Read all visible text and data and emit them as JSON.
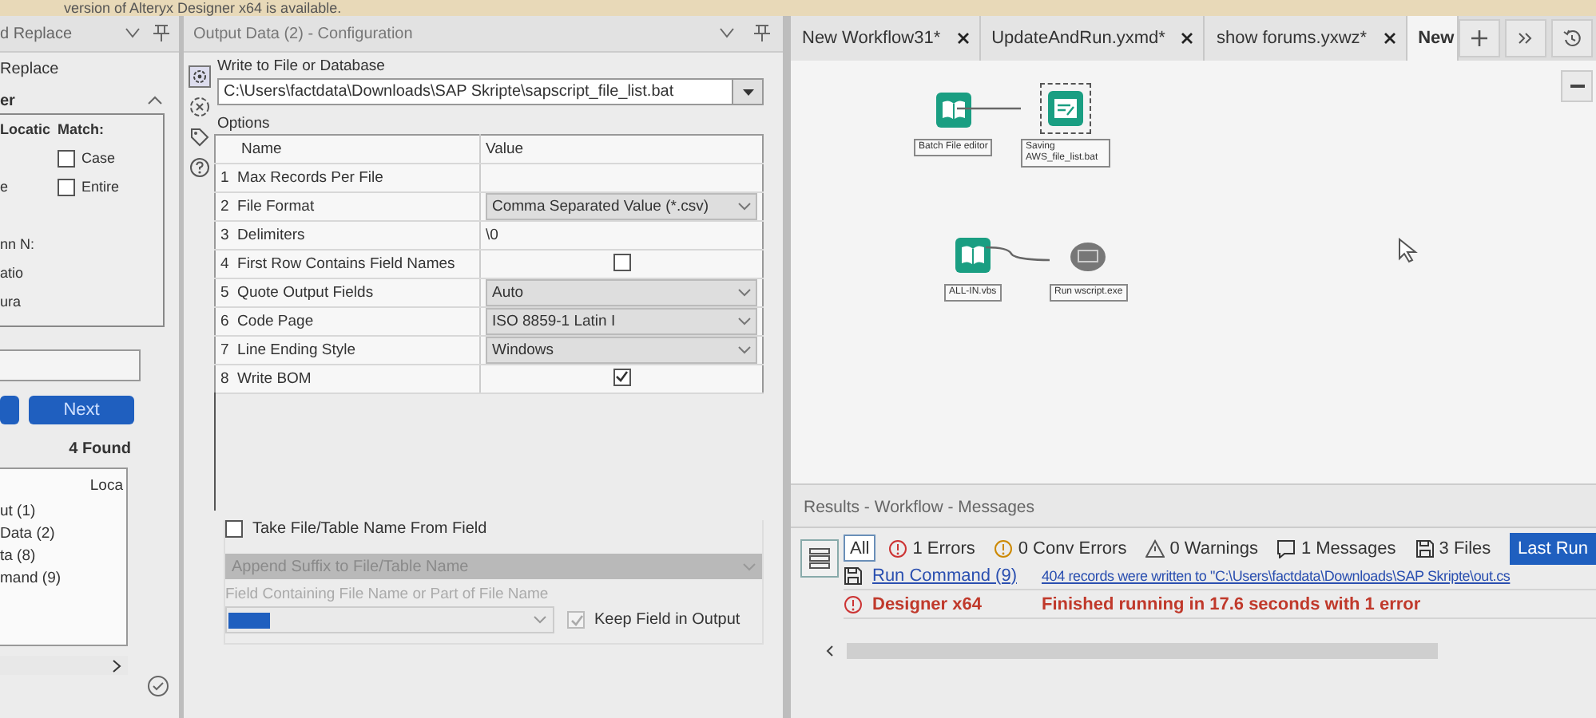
{
  "banner": "version of Alteryx Designer x64 is available.",
  "find_panel": {
    "title": "d Replace",
    "tab": "Replace",
    "section": "er",
    "location_header": "Locatic",
    "match_header": "Match:",
    "location_items": [
      "e",
      "nn N:",
      "atio",
      "ura"
    ],
    "match_options": [
      {
        "label": "Case",
        "checked": false
      },
      {
        "label": "Entire",
        "checked": false
      }
    ],
    "next_button": "Next",
    "found": "4 Found",
    "list_header": "Loca",
    "list_items": [
      "ut (1)",
      "Data (2)",
      "ta (8)",
      "mand (9)"
    ]
  },
  "config": {
    "title": "Output Data (2) - Configuration",
    "write_label": "Write to File or Database",
    "path": "C:\\Users\\factdata\\Downloads\\SAP Skripte\\sapscript_file_list.bat",
    "options_label": "Options",
    "columns": [
      "Name",
      "Value"
    ],
    "rows": [
      {
        "num": "1",
        "name": "Max Records Per File",
        "kind": "text",
        "value": ""
      },
      {
        "num": "2",
        "name": "File Format",
        "kind": "dropdown",
        "value": "Comma Separated Value (*.csv)"
      },
      {
        "num": "3",
        "name": "Delimiters",
        "kind": "text",
        "value": "\\0"
      },
      {
        "num": "4",
        "name": "First Row Contains Field Names",
        "kind": "checkbox",
        "checked": false
      },
      {
        "num": "5",
        "name": "Quote Output Fields",
        "kind": "dropdown",
        "value": "Auto"
      },
      {
        "num": "6",
        "name": "Code Page",
        "kind": "dropdown",
        "value": "ISO 8859-1 Latin I"
      },
      {
        "num": "7",
        "name": "Line Ending Style",
        "kind": "dropdown",
        "value": "Windows"
      },
      {
        "num": "8",
        "name": "Write BOM",
        "kind": "checkbox",
        "checked": true
      }
    ],
    "take_name": {
      "label": "Take File/Table Name From Field",
      "checked": false
    },
    "append_dropdown": {
      "value": "Append Suffix to File/Table Name",
      "disabled": true
    },
    "field_label": "Field Containing File Name or Part of File Name",
    "keep_field": {
      "label": "Keep Field in Output",
      "checked": true,
      "disabled": true
    }
  },
  "tabs": [
    {
      "label": "New Workflow31*",
      "selected": false
    },
    {
      "label": "UpdateAndRun.yxmd*",
      "selected": false
    },
    {
      "label": "show forums.yxwz*",
      "selected": false
    },
    {
      "label": "New",
      "selected": true
    }
  ],
  "canvas": {
    "nodes": [
      {
        "kind": "book",
        "label": "Batch File editor",
        "selected": false
      },
      {
        "kind": "output",
        "label": "Saving AWS_file_list.bat",
        "selected": true
      },
      {
        "kind": "book",
        "label": "ALL-IN.vbs",
        "selected": false
      },
      {
        "kind": "command",
        "label": "Run wscript.exe",
        "selected": false
      }
    ]
  },
  "results": {
    "title": "Results - Workflow - Messages",
    "filters": [
      {
        "kind": "all",
        "label": "All",
        "selected": true
      },
      {
        "kind": "error",
        "label": "1 Errors",
        "selected": false
      },
      {
        "kind": "conv",
        "label": "0 Conv Errors",
        "selected": false
      },
      {
        "kind": "warning",
        "label": "0 Warnings",
        "selected": false
      },
      {
        "kind": "message",
        "label": "1 Messages",
        "selected": false
      },
      {
        "kind": "file",
        "label": "3 Files",
        "selected": false
      }
    ],
    "last_run": "Last Run",
    "messages": [
      {
        "kind": "file",
        "tool": "Run Command (9)",
        "text": "404 records were written to \"C:\\Users\\factdata\\Downloads\\SAP Skripte\\out.cs"
      },
      {
        "kind": "error",
        "tool": "Designer x64",
        "text": "Finished running in 17.6 seconds with 1 error"
      }
    ]
  }
}
